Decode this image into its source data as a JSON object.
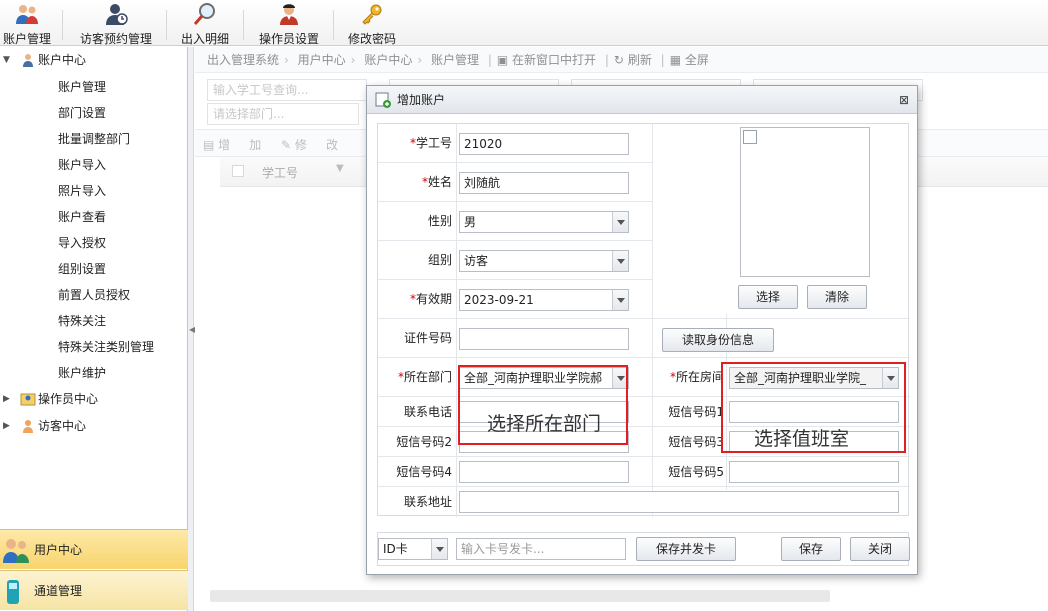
{
  "toolbar": {
    "items": [
      {
        "label": "账户管理",
        "icon": "users-icon"
      },
      {
        "label": "访客预约管理",
        "icon": "visitor-icon"
      },
      {
        "label": "出入明细",
        "icon": "magnifier-icon"
      },
      {
        "label": "操作员设置",
        "icon": "operator-icon"
      },
      {
        "label": "修改密码",
        "icon": "key-icon"
      }
    ]
  },
  "sidebar": {
    "root": "账户中心",
    "items": [
      "账户管理",
      "部门设置",
      "批量调整部门",
      "账户导入",
      "照片导入",
      "账户查看",
      "导入授权",
      "组别设置",
      "前置人员授权",
      "特殊关注",
      "特殊关注类别管理",
      "账户维护"
    ],
    "groups": [
      "操作员中心",
      "访客中心"
    ],
    "bottom_nav": [
      "用户中心",
      "通道管理"
    ]
  },
  "main": {
    "breadcrumb": [
      "出入管理系统",
      "用户中心",
      "账户中心",
      "账户管理"
    ],
    "breadcrumb_actions": [
      "在新窗口中打开",
      "刷新",
      "全屏"
    ],
    "filters": {
      "workid_placeholder": "输入学工号查询...",
      "dept_placeholder": "请选择部门..."
    },
    "grid_toolbar": [
      "增",
      "加",
      "修",
      "改"
    ],
    "grid_header": "学工号"
  },
  "dialog": {
    "title": "增加账户",
    "labels": {
      "workid": "学工号",
      "name": "姓名",
      "gender": "性别",
      "group": "组别",
      "valid": "有效期",
      "idno": "证件号码",
      "dept": "所在部门",
      "room": "所在房间",
      "phone": "联系电话",
      "sms1": "短信号码1",
      "sms2": "短信号码2",
      "sms3": "短信号码3",
      "sms4": "短信号码4",
      "sms5": "短信号码5",
      "address": "联系地址"
    },
    "values": {
      "workid": "21020",
      "name": "刘随航",
      "gender": "男",
      "group": "访客",
      "valid": "2023-09-21",
      "dept": "全部_河南护理职业学院郝",
      "room": "全部_河南护理职业学院_"
    },
    "buttons": {
      "select": "选择",
      "clear": "清除",
      "read_id": "读取身份信息",
      "save_issue": "保存并发卡",
      "save": "保存",
      "close": "关闭"
    },
    "footer": {
      "card_type": "ID卡",
      "card_placeholder": "输入卡号发卡..."
    }
  },
  "annotations": {
    "dept": "选择所在部门",
    "room": "选择值班室"
  },
  "colors": {
    "required": "#d40000",
    "annotation": "#e02020",
    "nav_active": "#f7d46c"
  }
}
